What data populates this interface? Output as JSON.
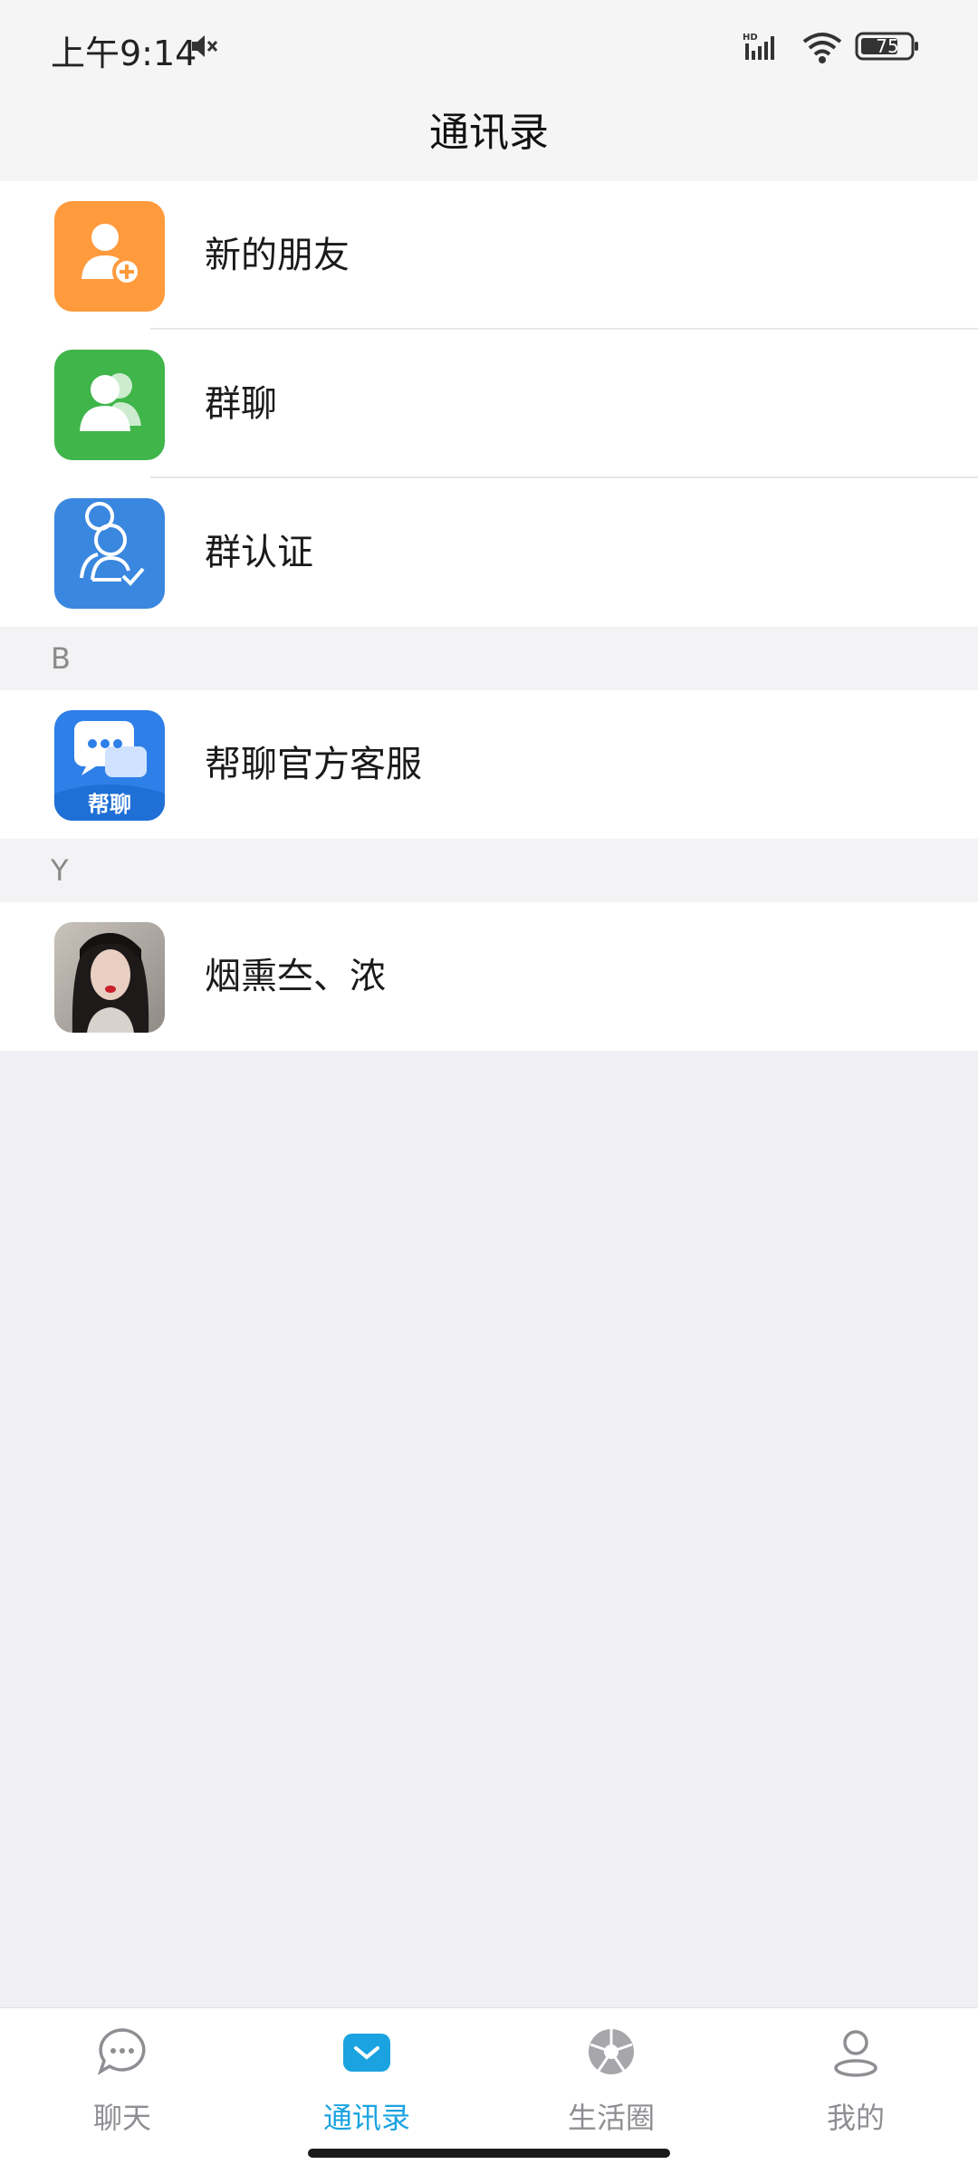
{
  "status_bar": {
    "time": "上午9:14",
    "battery": "75"
  },
  "nav": {
    "title": "通讯录"
  },
  "menu": [
    {
      "label": "新的朋友",
      "icon": "add-friend-icon",
      "color": "#ff9a3d"
    },
    {
      "label": "群聊",
      "icon": "group-chat-icon",
      "color": "#3fb54a"
    },
    {
      "label": "群认证",
      "icon": "group-verify-icon",
      "color": "#3a87e0"
    }
  ],
  "sections": [
    {
      "letter": "B",
      "contacts": [
        {
          "name": "帮聊官方客服",
          "avatar": "official-service-icon",
          "avatar_text": "帮聊"
        }
      ]
    },
    {
      "letter": "Y",
      "contacts": [
        {
          "name": "烟熏夳、浓",
          "avatar": "user-photo"
        }
      ]
    }
  ],
  "tabs": [
    {
      "label": "聊天",
      "icon": "chat-bubble-icon",
      "active": false
    },
    {
      "label": "通讯录",
      "icon": "contacts-mail-icon",
      "active": true
    },
    {
      "label": "生活圈",
      "icon": "aperture-icon",
      "active": false
    },
    {
      "label": "我的",
      "icon": "person-icon",
      "active": false
    }
  ],
  "colors": {
    "accent": "#1aa3e0",
    "background": "#efeff4"
  }
}
